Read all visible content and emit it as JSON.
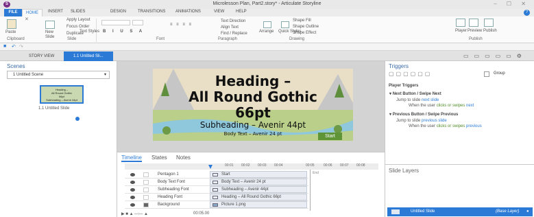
{
  "window": {
    "title": "Microlesson Plan, Part2.story* - Articulate Storyline",
    "app_icon": "S",
    "controls": "– ☐ ✕"
  },
  "ribbon_tabs": [
    "FILE",
    "HOME",
    "INSERT",
    "SLIDES",
    "DESIGN",
    "TRANSITIONS",
    "ANIMATIONS",
    "VIEW",
    "HELP"
  ],
  "ribbon": {
    "paste": "Paste",
    "new_slide": "New Slide",
    "apply_layout": "Apply Layout",
    "focus_order": "Focus Order",
    "duplicate": "Duplicate",
    "text_styles": "Text Styles",
    "text_direction": "Text Direction",
    "align_text": "Align Text",
    "find_replace": "Find / Replace",
    "arrange": "Arrange",
    "quick_styles": "Quick Styles",
    "shape_fill": "Shape Fill",
    "shape_outline": "Shape Outline",
    "shape_effect": "Shape Effect",
    "player": "Player",
    "preview": "Preview",
    "publish": "Publish",
    "groups": {
      "clipboard": "Clipboard",
      "slide": "Slide",
      "font": "Font",
      "paragraph": "Paragraph",
      "drawing": "Drawing",
      "publish": "Publish"
    }
  },
  "view_tabs": {
    "story_view": "STORY VIEW",
    "slide_tab": "1.1 Untitled Sli..."
  },
  "scenes": {
    "title": "Scenes",
    "selected": "1 Untitled Scene",
    "thumb_lines": [
      "Heading –",
      "All Round Gothic",
      "66pt",
      "Subheading – Avenir 44pt"
    ],
    "slide_label": "1.1 Untitled Slide"
  },
  "slide": {
    "heading_line1": "Heading –",
    "heading_line2": "All Round Gothic",
    "heading_line3": "66pt",
    "subheading": "Subheading – Avenir 44pt",
    "body": "Body Text – Avenir 24 pt",
    "start_button": "Start"
  },
  "timeline": {
    "tabs": [
      "Timeline",
      "States",
      "Notes"
    ],
    "ticks": [
      "00:01",
      "00:02",
      "00:03",
      "00:04",
      "00:05",
      "00:06",
      "00:07",
      "00:08"
    ],
    "end_label": "End",
    "time": "00:05.00",
    "rows": [
      {
        "name": "Pentagon 1",
        "bar": "Start",
        "locked": false
      },
      {
        "name": "Body Text Font",
        "bar": "Body Text – Avenir 24 pt",
        "locked": false
      },
      {
        "name": "Subheading Font",
        "bar": "Subheading – Avenir 44pt",
        "locked": false
      },
      {
        "name": "Heading Font",
        "bar": "Heading – All Round Gothic 66pt",
        "locked": false
      },
      {
        "name": "Background",
        "bar": "Picture 1.png",
        "locked": true
      }
    ]
  },
  "triggers": {
    "title": "Triggers",
    "group_label": "Group",
    "section": "Player Triggers",
    "next": {
      "head": "Next Button / Swipe Next",
      "action_pre": "Jump to slide ",
      "action_link": "next slide",
      "cond_pre": "When the user ",
      "cond_ok": "clicks or swipes",
      "cond_link": " next"
    },
    "prev": {
      "head": "Previous Button / Swipe Previous",
      "action_pre": "Jump to slide ",
      "action_link": "previous slide",
      "cond_pre": "When the user ",
      "cond_ok": "clicks or swipes",
      "cond_link": " previous"
    }
  },
  "layers": {
    "title": "Slide Layers",
    "row_name": "Untitled Slide",
    "row_tag": "(Base Layer)"
  },
  "colors": {
    "accent": "#2b7bd6",
    "start_button": "#5f9437",
    "brand": "#7b2e86"
  }
}
